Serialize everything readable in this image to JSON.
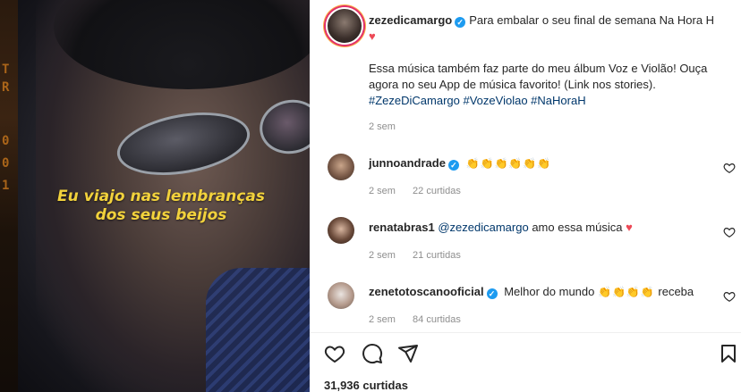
{
  "post": {
    "author": "zezedicamargo",
    "caption_line1": "Para embalar o seu final de semana Na Hora H",
    "caption_heart": "♥",
    "caption_para": "Essa música também faz parte do meu álbum Voz e Violão! Ouça agora no seu App de música favorito! (Link nos stories).",
    "hashtags": [
      "#ZezeDiCamargo",
      "#VozeViolao",
      "#NaHoraH"
    ],
    "time": "2 sem",
    "likes": "31,936 curtidas"
  },
  "video": {
    "lyrics_line1": "Eu viajo nas lembranças",
    "lyrics_line2": "dos seus beijos"
  },
  "comments": [
    {
      "user": "junnoandrade",
      "verified": true,
      "text": "👏👏👏👏👏👏",
      "time": "2 sem",
      "likes": "22 curtidas"
    },
    {
      "user": "renatabras1",
      "verified": false,
      "mention": "@zezedicamargo",
      "text": "amo essa música",
      "heart": "♥",
      "time": "2 sem",
      "likes": "21 curtidas"
    },
    {
      "user": "zenetotoscanooficial",
      "verified": true,
      "text_before": "Melhor do mundo",
      "claps": "👏👏👏👏",
      "text_after": "receba",
      "time": "2 sem",
      "likes": "84 curtidas"
    }
  ],
  "icons": {
    "like": "heart-outline-icon",
    "comment": "comment-icon",
    "share": "send-icon",
    "save": "bookmark-icon"
  },
  "colors": {
    "verified": "#1d9bf0",
    "hashtag": "#00376b",
    "lyrics": "#f2d23c",
    "heart": "#ed4956"
  }
}
